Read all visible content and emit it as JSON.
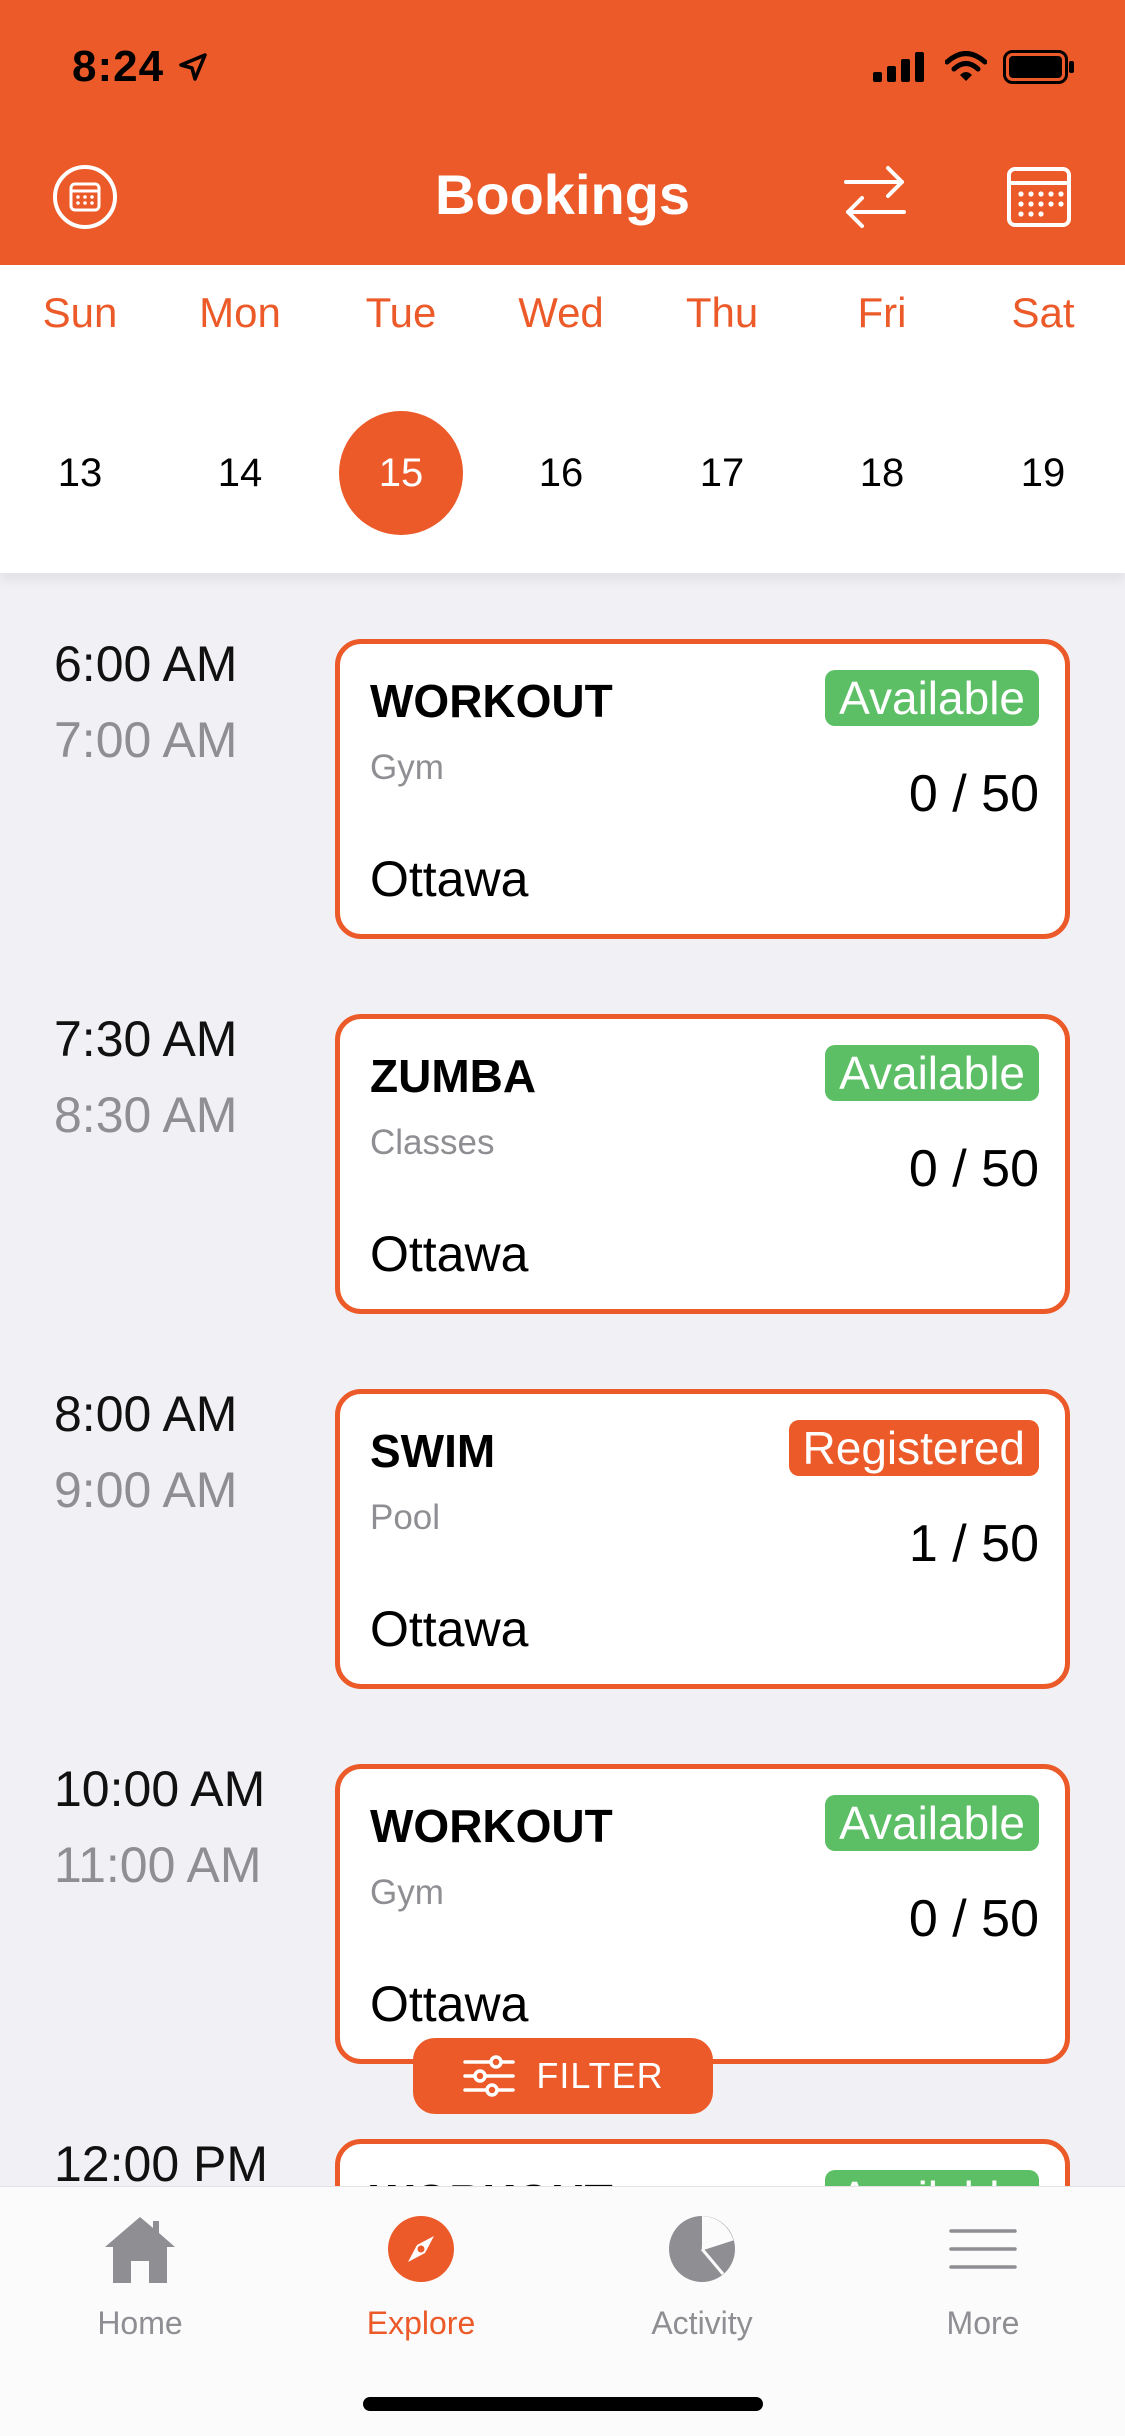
{
  "status_bar": {
    "time": "8:24"
  },
  "nav": {
    "title": "Bookings"
  },
  "week": {
    "days": [
      {
        "name": "Sun",
        "date": "13",
        "selected": false
      },
      {
        "name": "Mon",
        "date": "14",
        "selected": false
      },
      {
        "name": "Tue",
        "date": "15",
        "selected": true
      },
      {
        "name": "Wed",
        "date": "16",
        "selected": false
      },
      {
        "name": "Thu",
        "date": "17",
        "selected": false
      },
      {
        "name": "Fri",
        "date": "18",
        "selected": false
      },
      {
        "name": "Sat",
        "date": "19",
        "selected": false
      }
    ]
  },
  "bookings": [
    {
      "start": "6:00 AM",
      "end": "7:00 AM",
      "title": "WORKOUT",
      "category": "Gym",
      "status": "Available",
      "count": "0 / 50",
      "location": "Ottawa"
    },
    {
      "start": "7:30 AM",
      "end": "8:30 AM",
      "title": "ZUMBA",
      "category": "Classes",
      "status": "Available",
      "count": "0 / 50",
      "location": "Ottawa"
    },
    {
      "start": "8:00 AM",
      "end": "9:00 AM",
      "title": "SWIM",
      "category": "Pool",
      "status": "Registered",
      "count": "1 / 50",
      "location": "Ottawa"
    },
    {
      "start": "10:00 AM",
      "end": "11:00 AM",
      "title": "WORKOUT",
      "category": "Gym",
      "status": "Available",
      "count": "0 / 50",
      "location": "Ottawa"
    },
    {
      "start": "12:00 PM",
      "end": "",
      "title": "WORKOUT",
      "category": "",
      "status": "Available",
      "count": "",
      "location": ""
    }
  ],
  "filter": {
    "label": "FILTER"
  },
  "tabs": [
    {
      "label": "Home",
      "icon": "home-icon",
      "active": false
    },
    {
      "label": "Explore",
      "icon": "compass-icon",
      "active": true
    },
    {
      "label": "Activity",
      "icon": "pie-chart-icon",
      "active": false
    },
    {
      "label": "More",
      "icon": "menu-icon",
      "active": false
    }
  ],
  "colors": {
    "accent": "#eb5a28",
    "available": "#5cbf66",
    "secondary_text": "#8e8e93"
  }
}
